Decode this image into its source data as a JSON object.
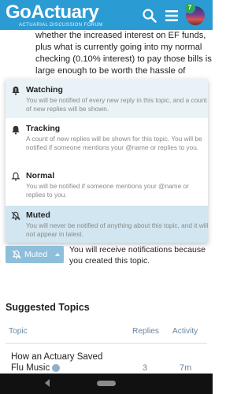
{
  "header": {
    "logo_text": "GoActuary",
    "logo_subtitle": "ACTUARIAL DISCUSSION FORUM",
    "notification_count": "7",
    "icons": [
      "search-icon",
      "menu-icon",
      "avatar"
    ]
  },
  "post": {
    "lines": [
      "whether the increased interest on EF funds,",
      "plus what is currently going into my normal",
      "checking (0.10% interest) to pay those bills is",
      "large enough to be worth the hassle of"
    ]
  },
  "notification_menu": {
    "options": [
      {
        "title": "Watching",
        "description": "You will be notified of every new reply in this topic, and a count of new replies will be shown.",
        "icon": "bell-exclamation-icon"
      },
      {
        "title": "Tracking",
        "description": "A count of new replies will be shown for this topic. You will be notified if someone mentions your @name or replies to you.",
        "icon": "bell-icon"
      },
      {
        "title": "Normal",
        "description": "You will be notified if someone mentions your @name or replies to you.",
        "icon": "bell-outline-icon"
      },
      {
        "title": "Muted",
        "description": "You will never be notified of anything about this topic, and it will not appear in latest.",
        "icon": "bell-slash-icon"
      }
    ],
    "selected": "Muted"
  },
  "muted_button": {
    "label": "Muted",
    "note": "You will receive notifications because you created this topic."
  },
  "suggested": {
    "heading": "Suggested Topics",
    "columns": [
      "Topic",
      "Replies",
      "Activity"
    ],
    "rows": [
      {
        "title_line1": "How an Actuary Saved",
        "title_line2": "Flu Music",
        "replies": "3",
        "activity": "7m"
      }
    ]
  },
  "colors": {
    "header": "#2b9bd3",
    "selected_option": "#d1e6f0",
    "muted_button": "#8dbfdb",
    "muted_text": "#8a8a8a",
    "column_header": "#6a86a0"
  }
}
